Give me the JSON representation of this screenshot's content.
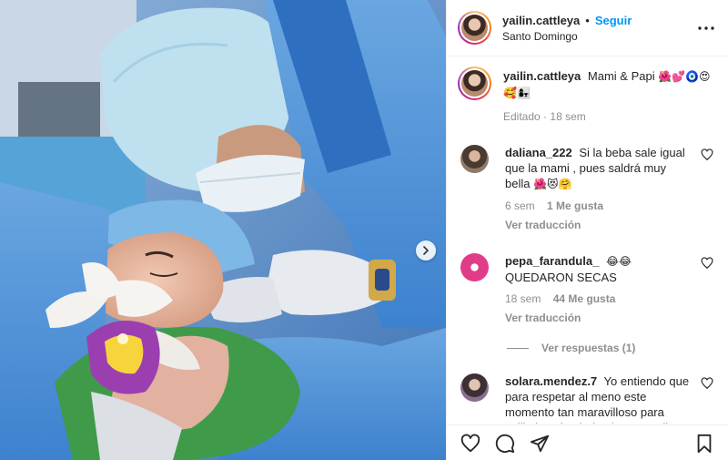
{
  "post": {
    "username": "yailin.cattleya",
    "separator": "•",
    "follow_label": "Seguir",
    "location": "Santo Domingo",
    "more_label": "•••"
  },
  "caption": {
    "username": "yailin.cattleya",
    "text": "Mami & Papi",
    "emoji": "🌺💕🧿😍🥰👩‍👧",
    "edited": "Editado",
    "dot": "·",
    "time": "18 sem"
  },
  "comments": [
    {
      "username": "daliana_222",
      "text": "Si la beba sale igual que la mami , pues saldrá muy bella",
      "emoji": "🌺😻🤗",
      "time": "6 sem",
      "likes": "1 Me gusta",
      "translate": "Ver traducción",
      "avatar_color": "#7a6a5e"
    },
    {
      "username": "pepa_farandula_",
      "text_emoji": "😂😂",
      "text": "QUEDARON SECAS",
      "time": "18 sem",
      "likes": "44 Me gusta",
      "translate": "Ver traducción",
      "avatar_color": "#e03c8a"
    },
    {
      "username": "solara.mendez.7",
      "text": "Yo entiendo que para respetar al meno este momento tan maravilloso para yailin la más viral quien sea q lleve esta página de ella que bloquee a",
      "avatar_color": "#8a6f8c"
    }
  ],
  "replies_label": "Ver respuestas (1)",
  "icons": {
    "like": "heart-icon",
    "comment": "comment-icon",
    "share": "share-icon",
    "save": "bookmark-icon",
    "next": "chevron-right-icon",
    "more": "more-icon"
  },
  "colors": {
    "accent": "#0095f6",
    "muted": "#8e8e8e",
    "text": "#262626"
  }
}
